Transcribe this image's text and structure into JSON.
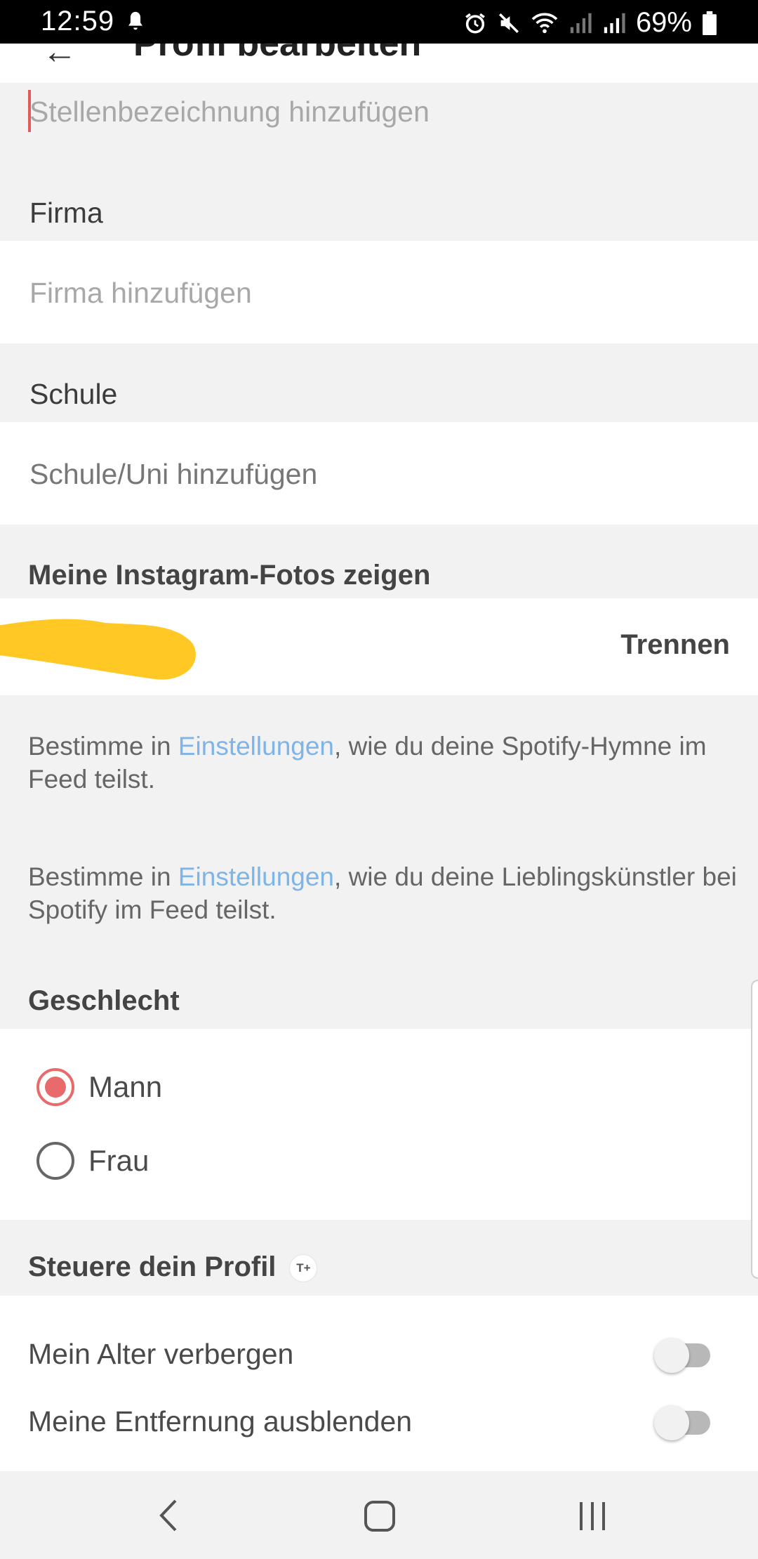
{
  "status": {
    "time": "12:59",
    "battery": "69%"
  },
  "header": {
    "back": "←",
    "title": "Profil bearbeiten"
  },
  "job": {
    "placeholder": "Stellenbezeichnung hinzufügen"
  },
  "company": {
    "label": "Firma",
    "placeholder": "Firma hinzufügen"
  },
  "school": {
    "label": "Schule",
    "placeholder": "Schule/Uni hinzufügen"
  },
  "instagram": {
    "label": "Meine Instagram-Fotos zeigen",
    "disconnect": "Trennen"
  },
  "spotify_anthem": {
    "prefix": "Bestimme in ",
    "link": "Einstellungen",
    "suffix": ", wie du deine Spotify-Hymne im Feed teilst."
  },
  "spotify_artists": {
    "prefix": "Bestimme in ",
    "link": "Einstellungen",
    "suffix": ", wie du deine Lieblingskünstler bei Spotify im Feed teilst."
  },
  "gender": {
    "label": "Geschlecht",
    "options": [
      {
        "label": "Mann",
        "selected": true
      },
      {
        "label": "Frau",
        "selected": false
      }
    ]
  },
  "profile_control": {
    "label": "Steuere dein Profil",
    "badge": "T+",
    "hide_age": {
      "label": "Mein Alter verbergen",
      "on": false
    },
    "hide_distance": {
      "label": "Meine Entfernung ausblenden",
      "on": false
    }
  },
  "colors": {
    "accent": "#e86a6a",
    "link": "#7fb4e6",
    "redaction": "#ffc824"
  },
  "icons": [
    "notification-icon",
    "alarm-icon",
    "mute-icon",
    "wifi-icon",
    "signal-icon",
    "battery-icon",
    "back-nav-icon",
    "home-nav-icon",
    "recents-nav-icon"
  ]
}
